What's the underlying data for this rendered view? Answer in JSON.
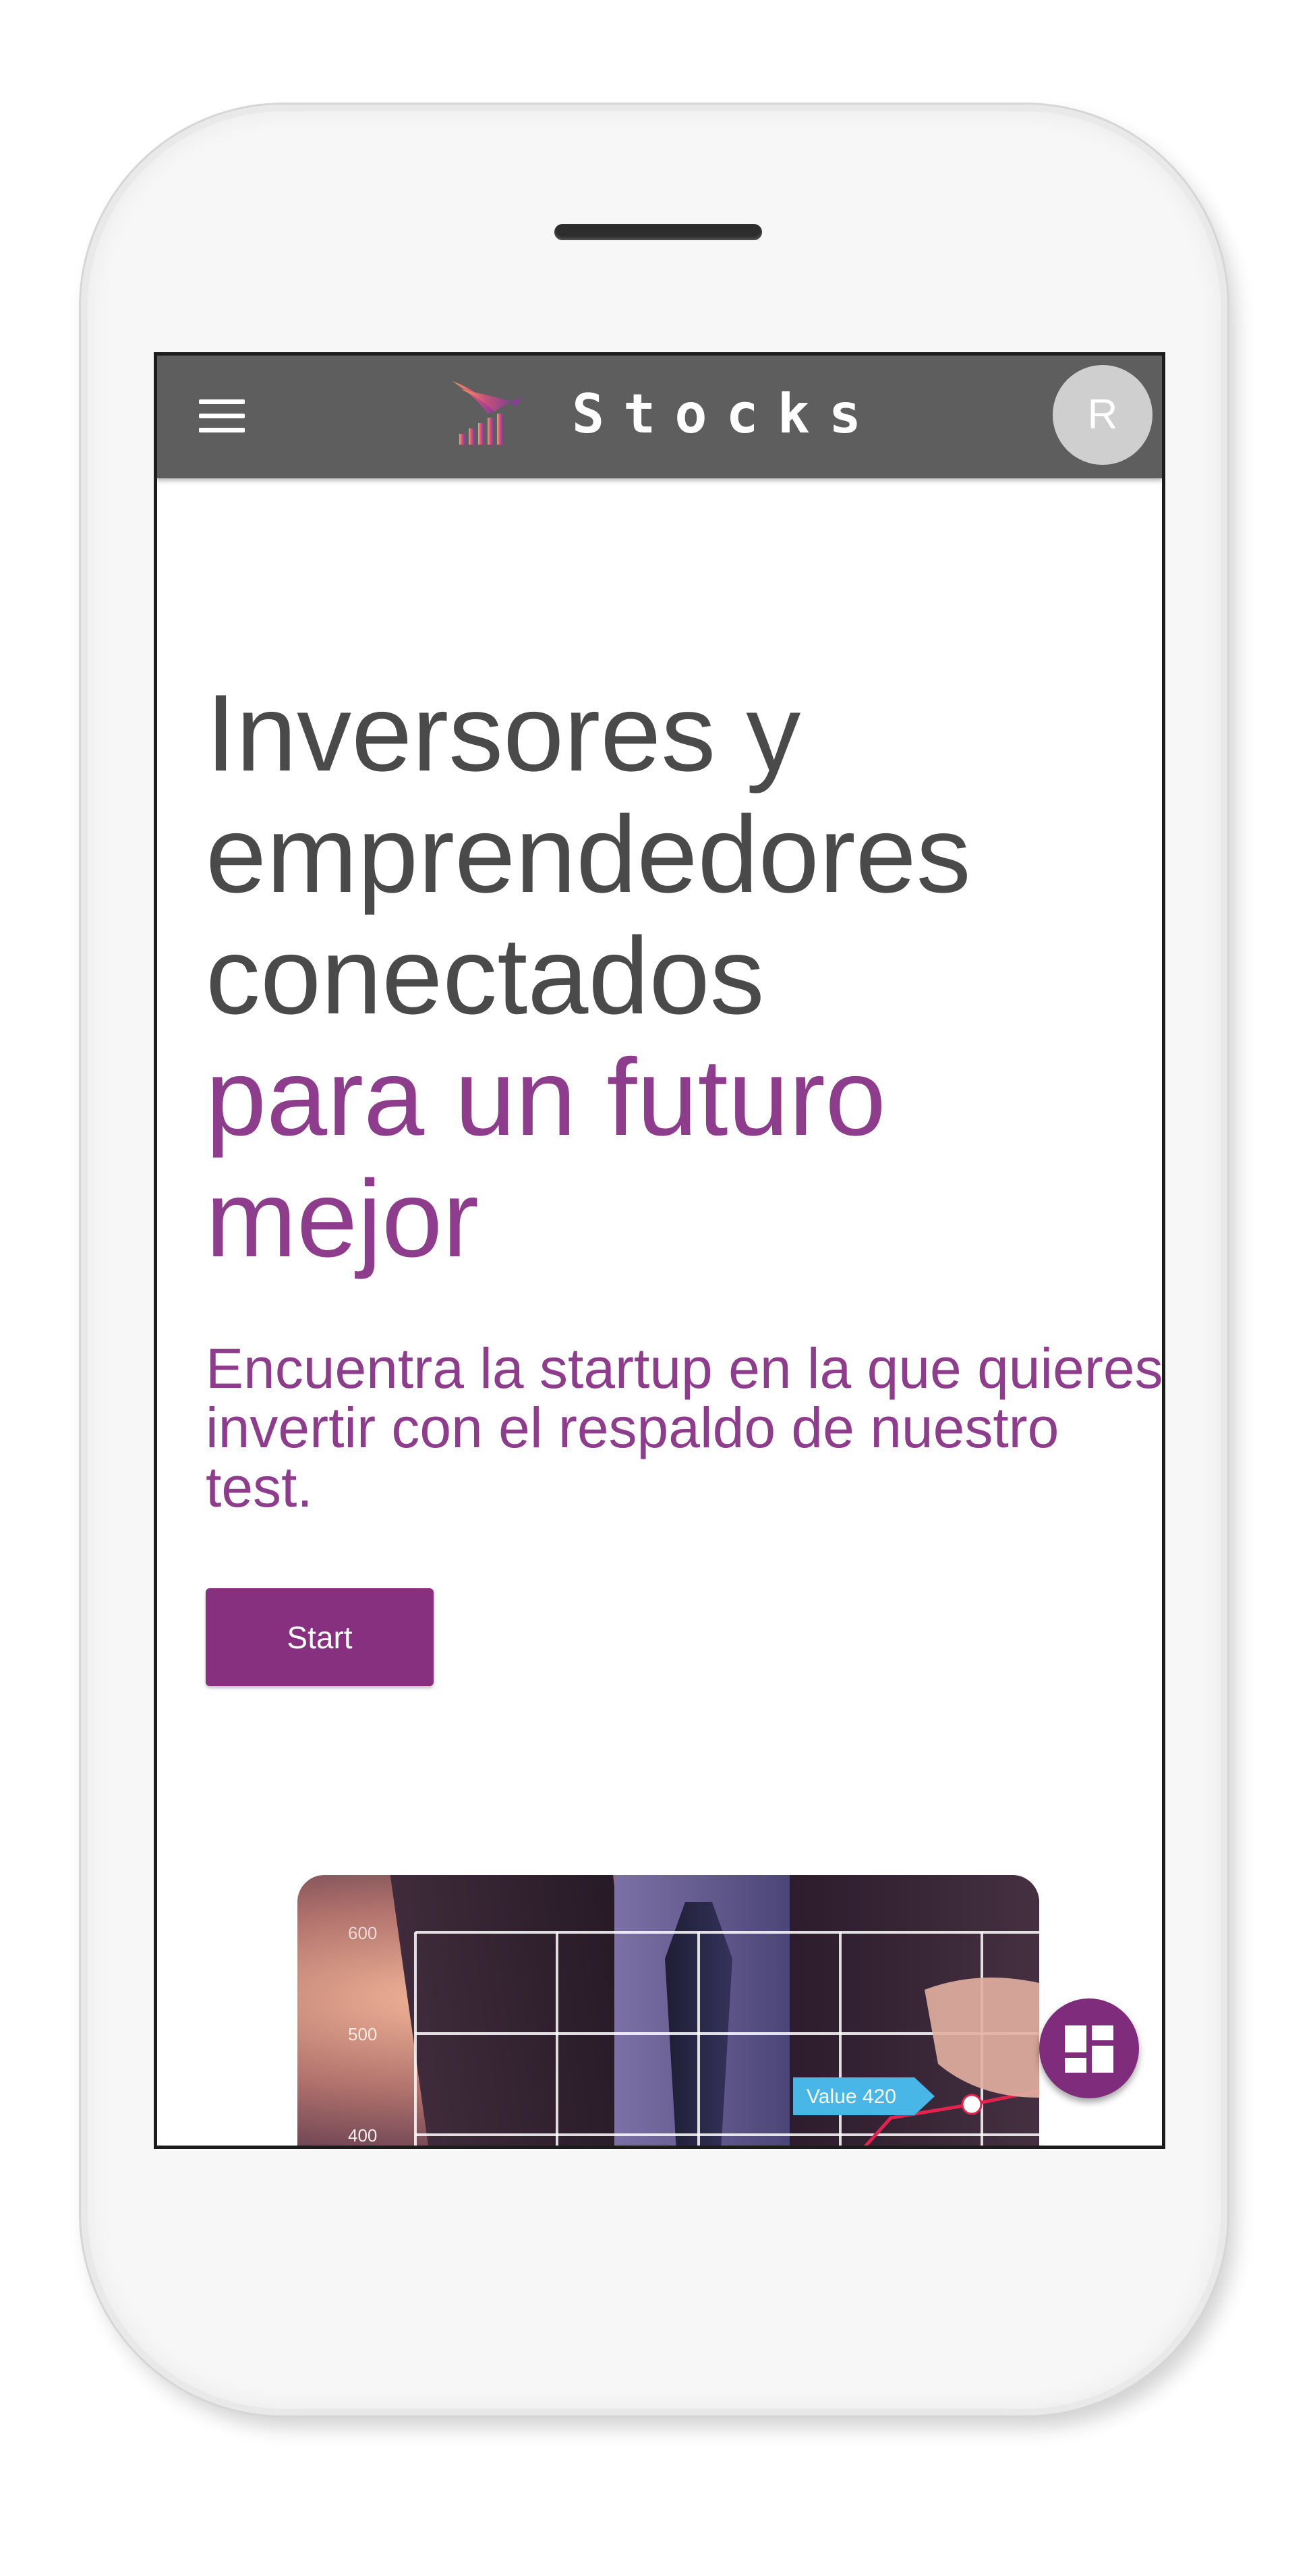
{
  "header": {
    "brand": "Stocks",
    "avatar_initial": "R"
  },
  "hero": {
    "title_line1": "Inversores y",
    "title_line2": "emprendedores",
    "title_line3": "conectados",
    "title_accent_line1": "para un futuro",
    "title_accent_line2": "mejor",
    "subtitle": "Encuentra la startup en la que quieres invertir con el respaldo de nuestro test.",
    "start_label": "Start"
  },
  "chart_photo": {
    "y_tick_labels": [
      "600",
      "500",
      "400"
    ],
    "callout": "Value 420"
  },
  "icons": {
    "menu": "hamburger-menu-icon",
    "logo": "bird-chart-logo-icon",
    "fab": "dashboard-grid-icon"
  },
  "colors": {
    "accent": "#8e3d8c",
    "button": "#86307f",
    "topbar": "#5e5e5e",
    "title_text": "#4a4a4a"
  }
}
